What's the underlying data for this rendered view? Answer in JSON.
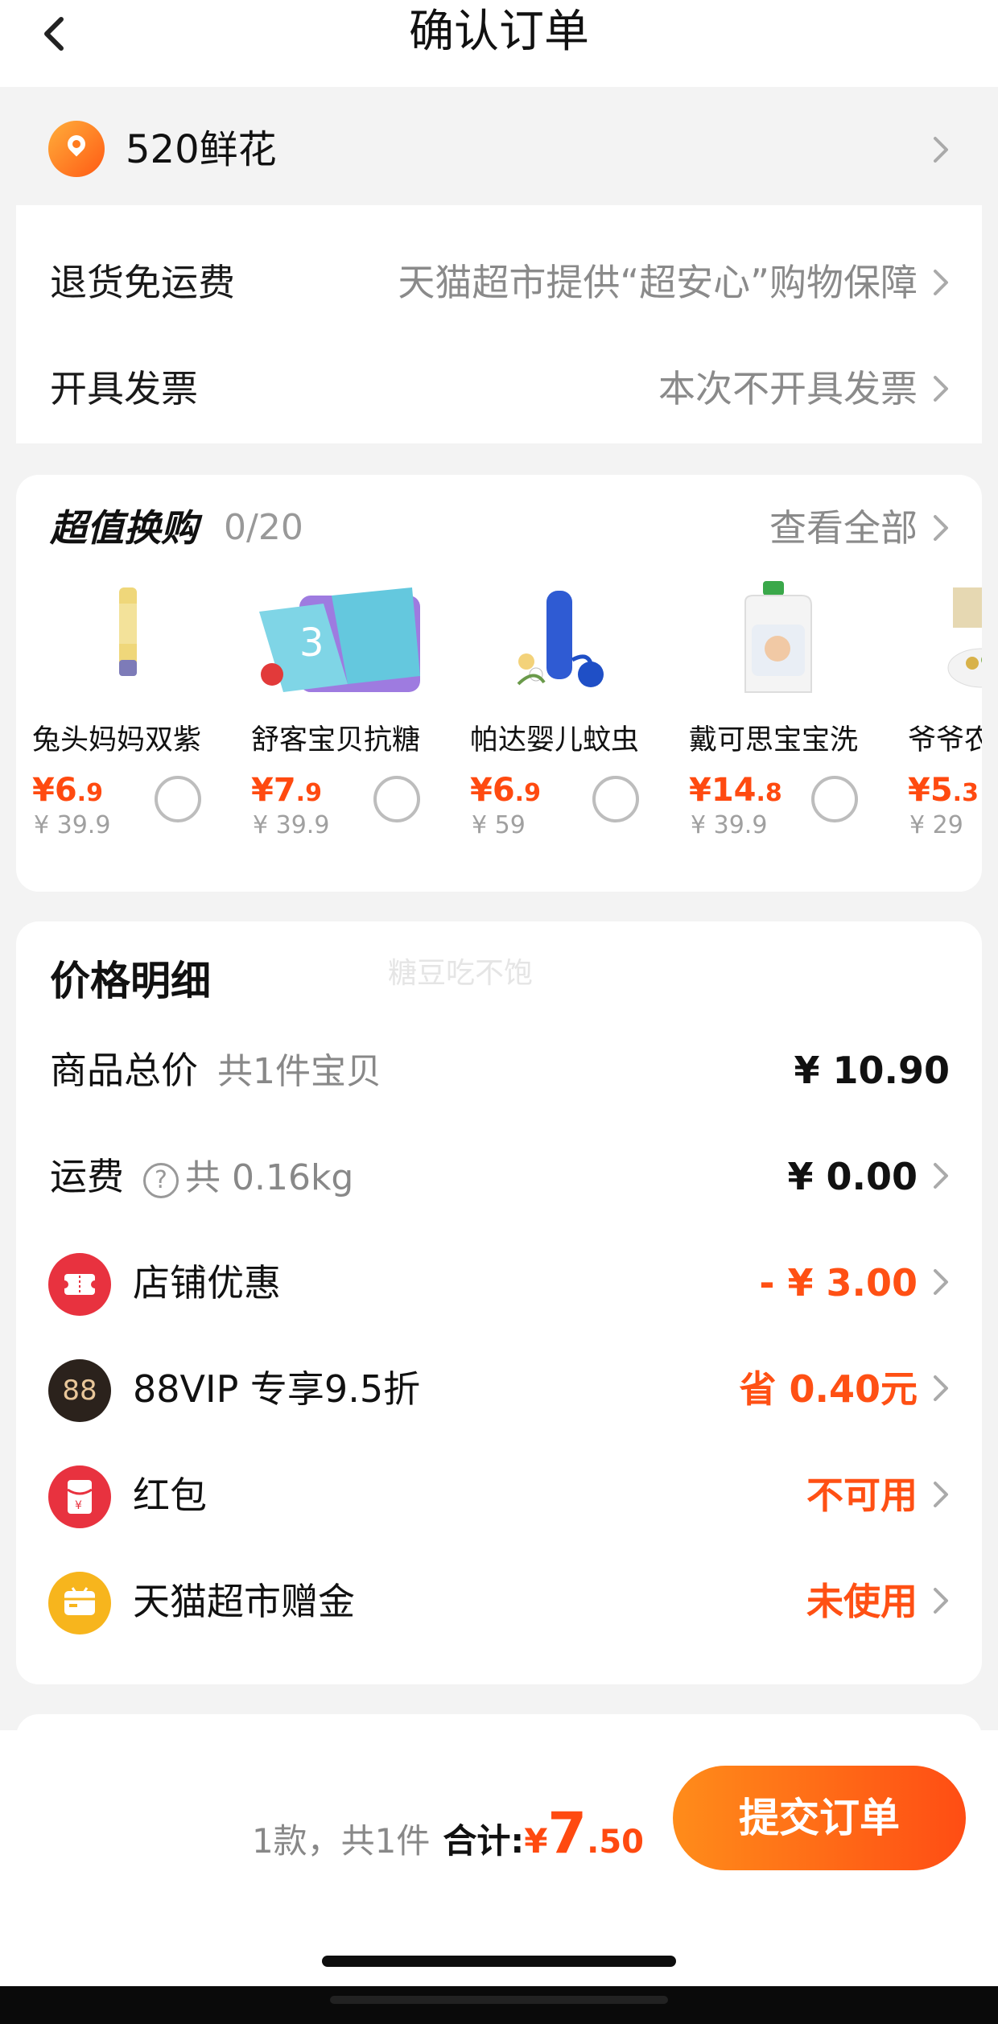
{
  "header": {
    "title": "确认订单"
  },
  "address": {
    "text": "520鲜花"
  },
  "services": {
    "return_label": "退货免运费",
    "return_value": "天猫超市提供“超安心”购物保障",
    "invoice_label": "开具发票",
    "invoice_value": "本次不开具发票"
  },
  "exchange": {
    "title": "超值换购",
    "count": "0/20",
    "view_all": "查看全部",
    "products": [
      {
        "name": "兔头妈妈双紫",
        "price_int": "¥6",
        "price_dec": ".9",
        "orig": "¥ 39.9"
      },
      {
        "name": "舒客宝贝抗糖",
        "price_int": "¥7",
        "price_dec": ".9",
        "orig": "¥ 39.9"
      },
      {
        "name": "帕达婴儿蚊虫",
        "price_int": "¥6",
        "price_dec": ".9",
        "orig": "¥ 59"
      },
      {
        "name": "戴可思宝宝洗",
        "price_int": "¥14",
        "price_dec": ".8",
        "orig": "¥ 39.9"
      },
      {
        "name": "爷爷农",
        "price_int": "¥5",
        "price_dec": ".3",
        "orig": "¥ 29"
      }
    ]
  },
  "price_detail": {
    "title": "价格明细",
    "watermark": "糖豆吃不饱",
    "goods_label": "商品总价",
    "goods_sub": "共1件宝贝",
    "goods_value": "¥ 10.90",
    "shipping_label": "运费",
    "shipping_sub": "共 0.16kg",
    "shipping_value": "¥ 0.00",
    "shop_discount_label": "店铺优惠",
    "shop_discount_value": "- ¥ 3.00",
    "vip_badge": "88",
    "vip_label": "88VIP 专享9.5折",
    "vip_value": "省 0.40元",
    "redpacket_label": "红包",
    "redpacket_value": "不可用",
    "gift_label": "天猫超市赠金",
    "gift_value": "未使用"
  },
  "footer": {
    "count": "1款，共1件",
    "total_label": "合计:",
    "total_currency": "¥",
    "total_int": "7",
    "total_dec": ".50",
    "submit": "提交订单"
  },
  "colors": {
    "accent": "#ff5014",
    "button_start": "#ff8c1a",
    "button_end": "#ff4d14"
  }
}
